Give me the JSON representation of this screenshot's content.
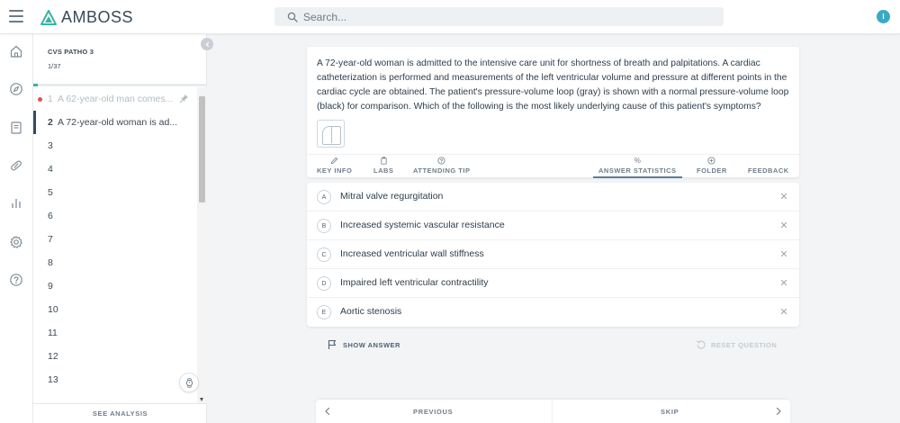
{
  "app": {
    "brand": "AMBOSS",
    "search_placeholder": "Search...",
    "user_initial": "I",
    "accent_color": "#36b5a2"
  },
  "rail_icons": [
    "home-icon",
    "compass-icon",
    "book-icon",
    "pill-icon",
    "bar-chart-icon",
    "gear-icon",
    "help-icon"
  ],
  "session": {
    "title": "CVS PATHO 3",
    "progress": "1/37",
    "progress_fraction": 0.027,
    "see_analysis": "SEE ANALYSIS"
  },
  "questions": [
    {
      "num": "1",
      "text": "A 62-year-old man comes...",
      "status": "answered"
    },
    {
      "num": "2",
      "text": "A 72-year-old woman is ad...",
      "status": "current"
    },
    {
      "num": "3",
      "text": ""
    },
    {
      "num": "4",
      "text": ""
    },
    {
      "num": "5",
      "text": ""
    },
    {
      "num": "6",
      "text": ""
    },
    {
      "num": "7",
      "text": ""
    },
    {
      "num": "8",
      "text": ""
    },
    {
      "num": "9",
      "text": ""
    },
    {
      "num": "10",
      "text": ""
    },
    {
      "num": "11",
      "text": ""
    },
    {
      "num": "12",
      "text": ""
    },
    {
      "num": "13",
      "text": ""
    }
  ],
  "question": {
    "stem": "A 72-year-old woman is admitted to the intensive care unit for shortness of breath and palpitations. A cardiac catheterization is performed and measurements of the left ventricular volume and pressure at different points in the cardiac cycle are obtained. The patient's pressure-volume loop (gray) is shown with a normal pressure-volume loop (black) for comparison. Which of the following is the most likely underlying cause of this patient's symptoms?",
    "tabs": {
      "key_info": "KEY INFO",
      "labs": "LABS",
      "attending_tip": "ATTENDING TIP",
      "answer_statistics": "ANSWER STATISTICS",
      "answer_statistics_symbol": "%",
      "folder": "FOLDER",
      "feedback": "FEEDBACK"
    }
  },
  "answers": [
    {
      "letter": "A",
      "text": "Mitral valve regurgitation"
    },
    {
      "letter": "B",
      "text": "Increased systemic vascular resistance"
    },
    {
      "letter": "C",
      "text": "Increased ventricular wall stiffness"
    },
    {
      "letter": "D",
      "text": "Impaired left ventricular contractility"
    },
    {
      "letter": "E",
      "text": "Aortic stenosis"
    }
  ],
  "actions": {
    "show_answer": "SHOW ANSWER",
    "reset_question": "RESET QUESTION"
  },
  "nav": {
    "previous": "PREVIOUS",
    "skip": "SKIP"
  }
}
